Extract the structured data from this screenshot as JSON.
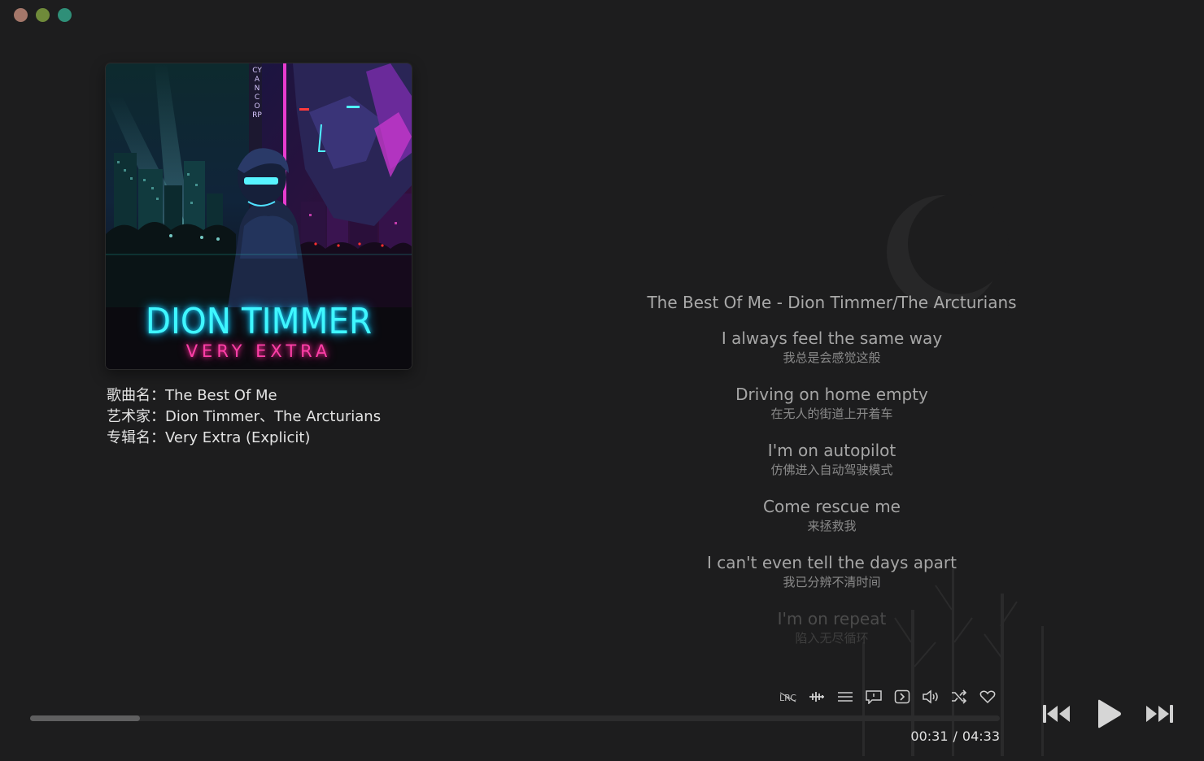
{
  "window": {
    "controls": [
      "close",
      "minimize",
      "maximize"
    ],
    "colors": {
      "close": "#a4776a",
      "minimize": "#6f8a3a",
      "maximize": "#2f8f78"
    }
  },
  "cover": {
    "artist_text": "DION TIMMER",
    "album_text": "VERY EXTRA",
    "vertical_text": "CYANCORP",
    "colors": {
      "artist_glow": "#3ff6ff",
      "album_glow": "#ff3fa8"
    }
  },
  "song_info": {
    "title_label": "歌曲名：",
    "title": "The Best Of Me",
    "artist_label": "艺术家：",
    "artist": "Dion Timmer、The Arctu­rians",
    "album_label": "专辑名：",
    "album": "Very Extra (Explicit)"
  },
  "lyrics": {
    "header": "The Best Of Me - Dion Timmer/The Arcturians",
    "lines": [
      {
        "en": "I always feel the same way",
        "zh": "我总是会感觉这般"
      },
      {
        "en": "Driving on home empty",
        "zh": "在无人的街道上开着车"
      },
      {
        "en": "I'm on autopilot",
        "zh": "仿佛进入自动驾驶模式"
      },
      {
        "en": "Come rescue me",
        "zh": "来拯救我"
      },
      {
        "en": "I can't even tell the days apart",
        "zh": "我已分辨不清时间"
      },
      {
        "en": "I'm on repeat",
        "zh": "陷入无尽循环"
      }
    ]
  },
  "controls": {
    "icons": [
      "lyrics-toggle-icon",
      "audio-effect-icon",
      "playlist-icon",
      "comment-icon",
      "next-track-small-icon",
      "volume-icon",
      "shuffle-icon",
      "favorite-icon"
    ],
    "lyric_icon_text": "LRC"
  },
  "playback": {
    "current_time": "00:31",
    "separator": "/",
    "total_time": "04:33",
    "progress": 0.1135
  },
  "transport": {
    "icons": [
      "previous-icon",
      "play-icon",
      "next-icon"
    ]
  }
}
